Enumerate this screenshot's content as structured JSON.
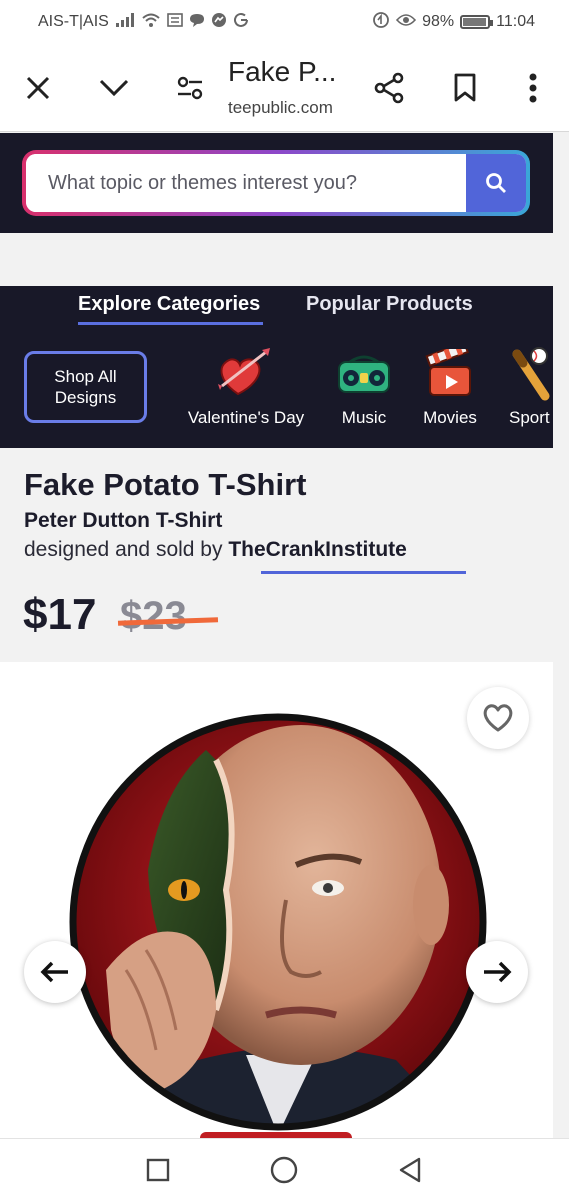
{
  "status_bar": {
    "carrier": "AIS-T|AIS",
    "battery": "98%",
    "battery_level": 0.98,
    "time": "11:04"
  },
  "browser": {
    "title": "Fake P...",
    "url": "teepublic.com"
  },
  "search": {
    "placeholder": "What topic or themes interest you?"
  },
  "categories": {
    "tabs": [
      "Explore Categories",
      "Popular Products"
    ],
    "shop_all": "Shop All Designs",
    "items": [
      {
        "label": "Valentine's Day",
        "icon": "heart-arrow-icon"
      },
      {
        "label": "Music",
        "icon": "boombox-icon"
      },
      {
        "label": "Movies",
        "icon": "clapperboard-icon"
      },
      {
        "label": "Sport",
        "icon": "bat-ball-icon"
      }
    ]
  },
  "product": {
    "title": "Fake Potato T-Shirt",
    "subtitle": "Peter Dutton T-Shirt",
    "by_prefix": "designed and sold by ",
    "designer": "TheCrankInstitute",
    "price": "$17",
    "old_price": "$23"
  },
  "colors": {
    "dark_band": "#181828",
    "accent_blue": "#5165d9",
    "strike_orange": "#f0693a"
  }
}
